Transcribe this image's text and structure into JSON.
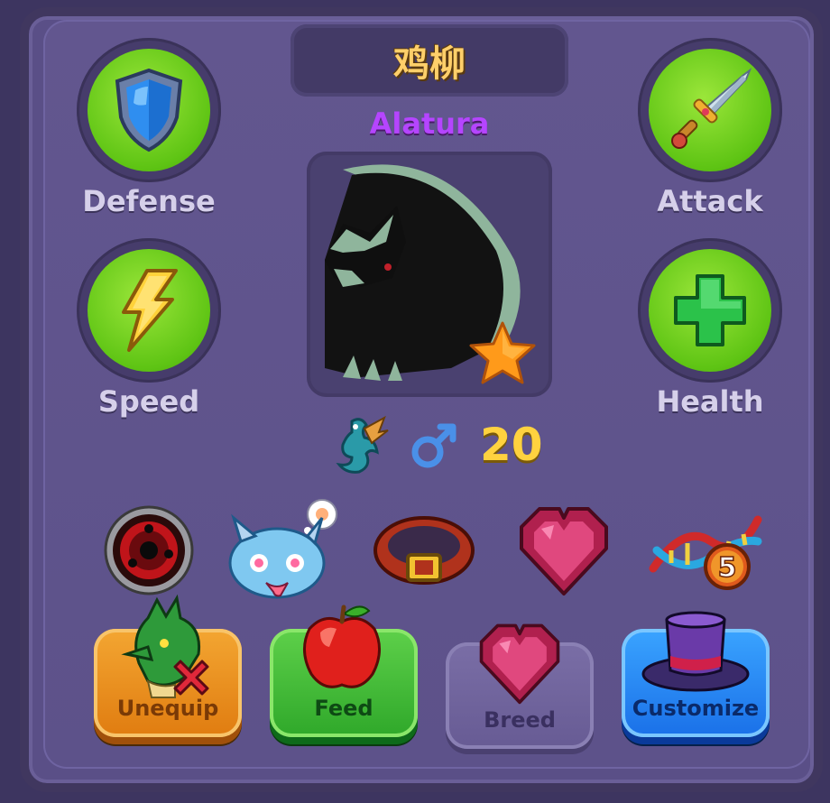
{
  "dragon": {
    "name": "鸡柳",
    "species": "Alatura",
    "level": "20"
  },
  "stats": {
    "defense": "Defense",
    "attack": "Attack",
    "speed": "Speed",
    "health": "Health"
  },
  "buttons": {
    "unequip": "Unequip",
    "feed": "Feed",
    "breed": "Breed",
    "customize": "Customize"
  },
  "equipment_badge": "5",
  "colors": {
    "panel": "#5a4f87",
    "stat_green": "#5ec414",
    "name_gold": "#ffcf6a",
    "species_purple": "#b545ff",
    "level_yellow": "#ffd23f",
    "unequip_orange": "#e98a1c",
    "feed_green": "#3fb82a",
    "breed_gray": "#6c6096",
    "customize_blue": "#1f7ff0"
  }
}
